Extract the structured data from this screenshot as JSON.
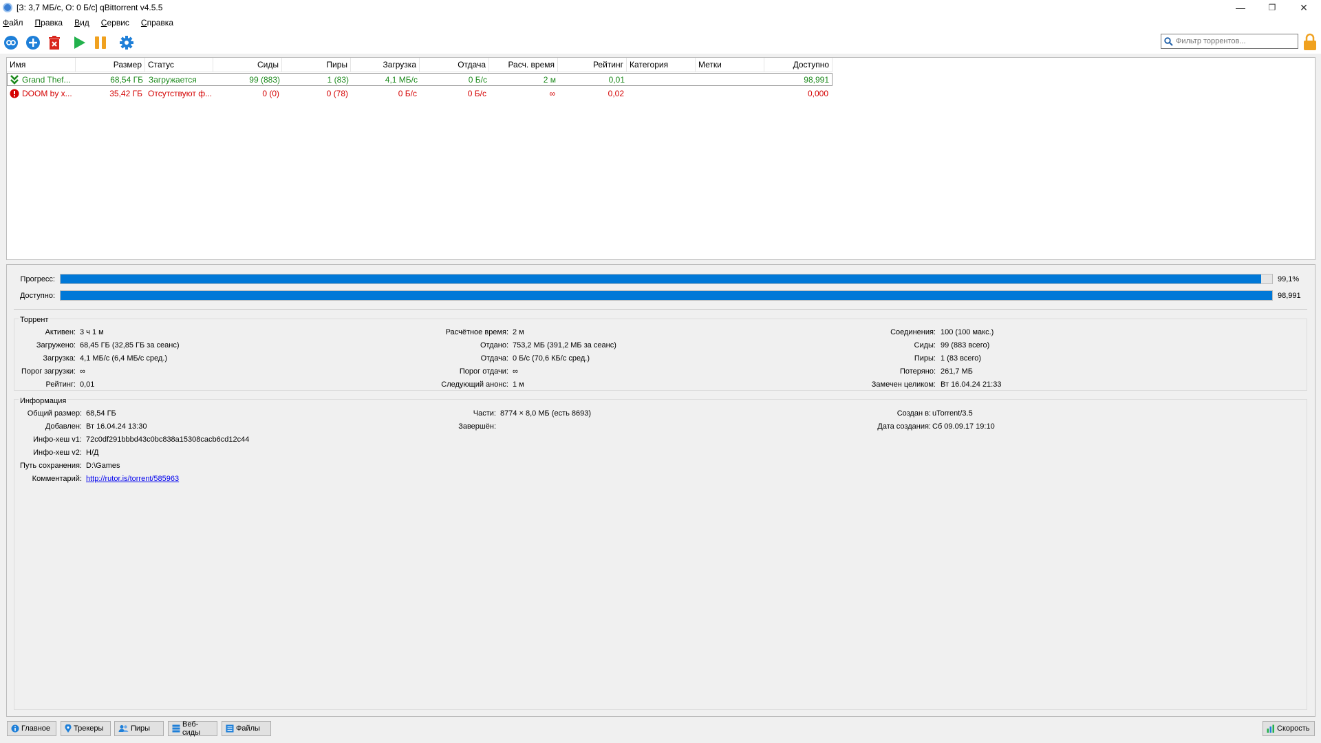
{
  "window": {
    "title": "[З: 3,7 МБ/с, О: 0 Б/с] qBittorrent v4.5.5",
    "minimize": "—",
    "maximize": "❐",
    "close": "✕"
  },
  "menu": [
    "Файл",
    "Правка",
    "Вид",
    "Сервис",
    "Справка"
  ],
  "toolbar": {
    "icons": [
      "add-link-icon",
      "add-torrent-icon",
      "delete-icon",
      "resume-icon",
      "pause-icon",
      "settings-icon"
    ],
    "search_placeholder": "Фильтр торрентов...",
    "colors": {
      "blue": "#1e7fd8",
      "red": "#d9261c",
      "green": "#22b14c",
      "orange": "#f0a11f"
    }
  },
  "torrent_list": {
    "columns": [
      "Имя",
      "Размер",
      "Статус",
      "Сиды",
      "Пиры",
      "Загрузка",
      "Отдача",
      "Расч. время",
      "Рейтинг",
      "Категория",
      "Метки",
      "Доступно"
    ],
    "rows": [
      {
        "status_icon": "downloading-icon",
        "name": "Grand Thef...",
        "size": "68,54 ГБ",
        "status": "Загружается",
        "seeds": "99 (883)",
        "peers": "1 (83)",
        "down": "4,1 МБ/с",
        "up": "0 Б/с",
        "eta": "2 м",
        "ratio": "0,01",
        "category": "",
        "tags": "",
        "availability": "98,991",
        "color": "#1d8a1d"
      },
      {
        "status_icon": "error-icon",
        "name": "DOOM by x...",
        "size": "35,42 ГБ",
        "status": "Отсутствуют ф...",
        "seeds": "0 (0)",
        "peers": "0 (78)",
        "down": "0 Б/с",
        "up": "0 Б/с",
        "eta": "∞",
        "ratio": "0,02",
        "category": "",
        "tags": "",
        "availability": "0,000",
        "color": "#d40000"
      }
    ]
  },
  "progress": {
    "label": "Прогресс:",
    "value": "99,1%",
    "fraction": 0.991,
    "avail_label": "Доступно:",
    "avail_value": "98,991",
    "avail_fraction": 1.0,
    "bar_color": "#0078d7"
  },
  "transfer": {
    "title": "Торрент",
    "active_label": "Активен:",
    "active": "3 ч 1 м",
    "downloaded_label": "Загружено:",
    "downloaded": "68,45 ГБ (32,85 ГБ за сеанс)",
    "dl_speed_label": "Загрузка:",
    "dl_speed": "4,1 МБ/с (6,4 МБ/с сред.)",
    "dl_limit_label": "Порог загрузки:",
    "dl_limit": "∞",
    "ratio_label": "Рейтинг:",
    "ratio": "0,01",
    "eta_label": "Расчётное время:",
    "eta": "2 м",
    "uploaded_label": "Отдано:",
    "uploaded": "753,2 МБ (391,2 МБ за сеанс)",
    "ul_speed_label": "Отдача:",
    "ul_speed": "0 Б/с (70,6 КБ/с сред.)",
    "ul_limit_label": "Порог отдачи:",
    "ul_limit": "∞",
    "reannounce_label": "Следующий анонс:",
    "reannounce": "1 м",
    "connections_label": "Соединения:",
    "connections": "100 (100 макс.)",
    "seeds_label": "Сиды:",
    "seeds": "99 (883 всего)",
    "peers_label": "Пиры:",
    "peers": "1 (83 всего)",
    "wasted_label": "Потеряно:",
    "wasted": "261,7 МБ",
    "last_seen_label": "Замечен целиком:",
    "last_seen": "Вт 16.04.24 21:33"
  },
  "information": {
    "title": "Информация",
    "total_size_label": "Общий размер:",
    "total_size": "68,54 ГБ",
    "added_label": "Добавлен:",
    "added": "Вт 16.04.24 13:30",
    "hash_v1_label": "Инфо-хеш v1:",
    "hash_v1": "72c0df291bbbd43c0bc838a15308cacb6cd12c44",
    "hash_v2_label": "Инфо-хеш v2:",
    "hash_v2": "Н/Д",
    "save_path_label": "Путь сохранения:",
    "save_path": "D:\\Games",
    "comment_label": "Комментарий:",
    "comment": "http://rutor.is/torrent/585963",
    "pieces_label": "Части:",
    "pieces": "8774 × 8,0 МБ (есть 8693)",
    "completed_label": "Завершён:",
    "completed": "",
    "created_by_label": "Создан в:",
    "created_by": "uTorrent/3.5",
    "created_on_label": "Дата создания:",
    "created_on": "Сб 09.09.17 19:10"
  },
  "tabs": {
    "general": "Главное",
    "trackers": "Трекеры",
    "peers": "Пиры",
    "webseeds": "Веб-сиды",
    "files": "Файлы",
    "speed": "Скорость"
  }
}
